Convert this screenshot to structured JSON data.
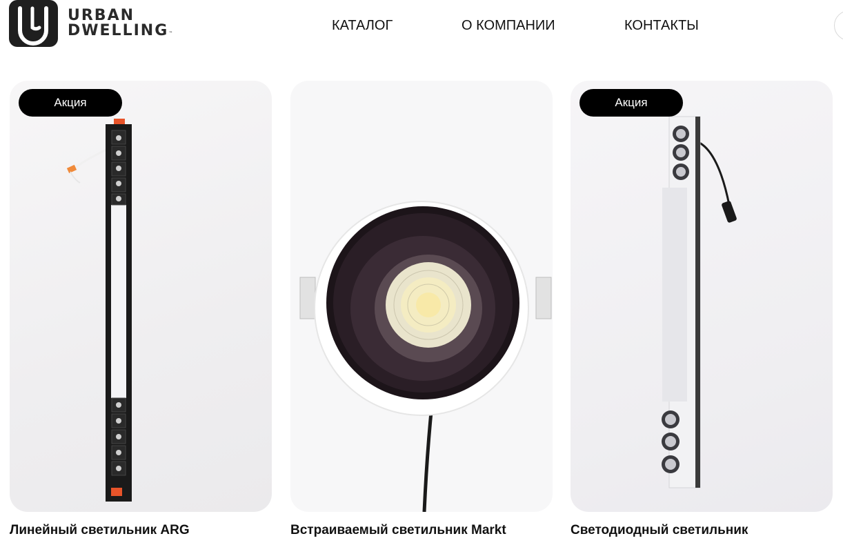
{
  "brand": {
    "line1": "URBAN",
    "line2": "DWELLING",
    "tm": "™"
  },
  "nav": {
    "catalog": "КАТАЛОГ",
    "about": "О КОМПАНИИ",
    "contacts": "КОНТАКТЫ"
  },
  "products": [
    {
      "badge": "Акция",
      "title": "Линейный светильник ARG",
      "image_icon": "linear-light-image"
    },
    {
      "badge": "",
      "title": "Встраиваемый светильник Markt",
      "image_icon": "recessed-light-image"
    },
    {
      "badge": "Акция",
      "title": "Светодиодный светильник",
      "image_icon": "led-light-image"
    }
  ],
  "colors": {
    "badge_bg": "#000000",
    "badge_text": "#ffffff",
    "accent_orange": "#e8542a"
  }
}
